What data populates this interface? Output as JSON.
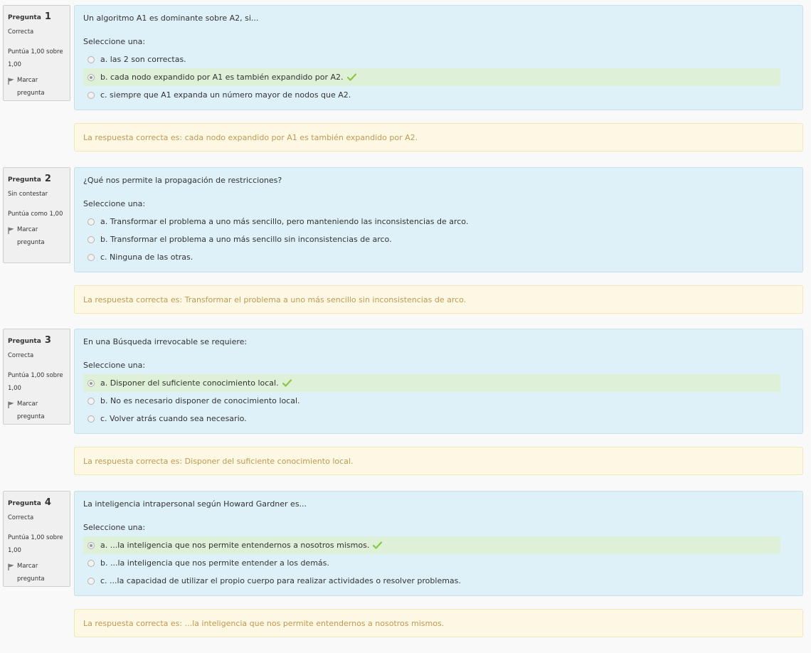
{
  "labels": {
    "question_prefix": "Pregunta",
    "flag": "Marcar pregunta",
    "prompt": "Seleccione una:",
    "correct_prefix": "La respuesta correcta es: "
  },
  "colors": {
    "question_bg": "#def0f8",
    "info_bg": "#f0f0f0",
    "correct_row_bg": "#dff0d8",
    "feedback_bg": "#fcf8e3",
    "feedback_text": "#c09853",
    "check": "#8cc63f"
  },
  "questions": [
    {
      "number": "1",
      "state": "Correcta",
      "grade": "Puntúa 1,00 sobre 1,00",
      "text": "Un algoritmo A1 es dominante sobre A2, si...",
      "answers": [
        {
          "letter": "a.",
          "text": "las 2 son correctas.",
          "selected": false,
          "correct": false
        },
        {
          "letter": "b.",
          "text": "cada nodo expandido por A1 es también expandido por A2.",
          "selected": true,
          "correct": true
        },
        {
          "letter": "c.",
          "text": "siempre que A1 expanda un número mayor de nodos que A2.",
          "selected": false,
          "correct": false
        }
      ],
      "feedback": "La respuesta correcta es: cada nodo expandido por A1 es también expandido por A2."
    },
    {
      "number": "2",
      "state": "Sin contestar",
      "grade": "Puntúa como 1,00",
      "text": "¿Qué nos permite la propagación de restricciones?",
      "answers": [
        {
          "letter": "a.",
          "text": "Transformar el problema a uno más sencillo, pero manteniendo las inconsistencias de arco.",
          "selected": false,
          "correct": false
        },
        {
          "letter": "b.",
          "text": "Transformar el problema a uno más sencillo sin inconsistencias de arco.",
          "selected": false,
          "correct": false
        },
        {
          "letter": "c.",
          "text": "Ninguna de las otras.",
          "selected": false,
          "correct": false
        }
      ],
      "feedback": "La respuesta correcta es: Transformar el problema a uno más sencillo sin inconsistencias de arco."
    },
    {
      "number": "3",
      "state": "Correcta",
      "grade": "Puntúa 1,00 sobre 1,00",
      "text": "En una Búsqueda irrevocable se requiere:",
      "answers": [
        {
          "letter": "a.",
          "text": "Disponer del suficiente conocimiento local.",
          "selected": true,
          "correct": true
        },
        {
          "letter": "b.",
          "text": "No es necesario disponer de conocimiento local.",
          "selected": false,
          "correct": false
        },
        {
          "letter": "c.",
          "text": "Volver atrás cuando sea necesario.",
          "selected": false,
          "correct": false
        }
      ],
      "feedback": "La respuesta correcta es: Disponer del suficiente conocimiento local."
    },
    {
      "number": "4",
      "state": "Correcta",
      "grade": "Puntúa 1,00 sobre 1,00",
      "text": "La inteligencia intrapersonal según Howard Gardner es...",
      "answers": [
        {
          "letter": "a.",
          "text": "...la inteligencia que nos permite entendernos a nosotros mismos.",
          "selected": true,
          "correct": true
        },
        {
          "letter": "b.",
          "text": "...la inteligencia que nos permite entender a los demás.",
          "selected": false,
          "correct": false
        },
        {
          "letter": "c.",
          "text": "...la capacidad de utilizar el propio cuerpo para realizar actividades o resolver problemas.",
          "selected": false,
          "correct": false
        }
      ],
      "feedback": "La respuesta correcta es: ...la inteligencia que nos permite entendernos a nosotros mismos."
    }
  ]
}
